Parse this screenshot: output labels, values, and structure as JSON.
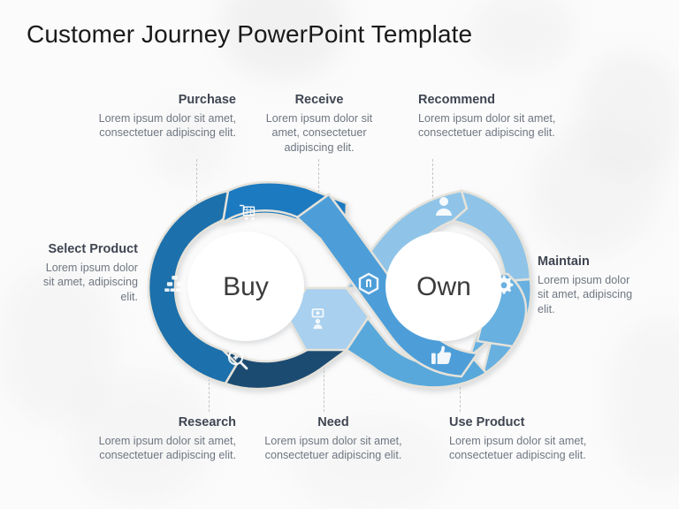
{
  "page": {
    "title": "Customer Journey PowerPoint Template",
    "background_color": "#fbfbfb"
  },
  "diagram": {
    "type": "infinity-loop",
    "left_loop_label": "Buy",
    "right_loop_label": "Own",
    "colors": {
      "purchase": "#1f7ac0",
      "select_product": "#1f6fab",
      "research": "#1b4c72",
      "need": "#a9d0ee",
      "receive": "#4d9ed8",
      "recommend": "#8fc4e8",
      "maintain": "#67b0e0",
      "use_product": "#59a8db",
      "hub": "#ffffff",
      "outline": "#e3e0d8"
    }
  },
  "callouts": [
    {
      "id": "purchase",
      "title": "Purchase",
      "body": "Lorem ipsum dolor sit amet, consectetuer adipiscing elit.",
      "align": "right",
      "icon": "shopping-cart-icon"
    },
    {
      "id": "receive",
      "title": "Receive",
      "body": "Lorem ipsum dolor sit amet, consectetuer adipiscing elit.",
      "align": "center",
      "icon": "package-box-icon"
    },
    {
      "id": "recommend",
      "title": "Recommend",
      "body": "Lorem ipsum dolor sit amet, consectetuer adipiscing elit.",
      "align": "left",
      "icon": "person-icon"
    },
    {
      "id": "select_product",
      "title": "Select Product",
      "body": "Lorem ipsum dolor sit amet, adipiscing elit.",
      "align": "right",
      "icon": "hierarchy-icon"
    },
    {
      "id": "maintain",
      "title": "Maintain",
      "body": "Lorem ipsum dolor sit amet, adipiscing elit.",
      "align": "left",
      "icon": "gear-icon"
    },
    {
      "id": "research",
      "title": "Research",
      "body": "Lorem ipsum dolor sit amet, consectetuer adipiscing elit.",
      "align": "right",
      "icon": "magnifier-plus-icon"
    },
    {
      "id": "need",
      "title": "Need",
      "body": "Lorem ipsum dolor sit amet, consectetuer adipiscing elit.",
      "align": "center",
      "icon": "presentation-person-icon"
    },
    {
      "id": "use_product",
      "title": "Use Product",
      "body": "Lorem ipsum dolor sit amet, consectetuer adipiscing elit.",
      "align": "left",
      "icon": "thumbs-up-icon"
    }
  ]
}
